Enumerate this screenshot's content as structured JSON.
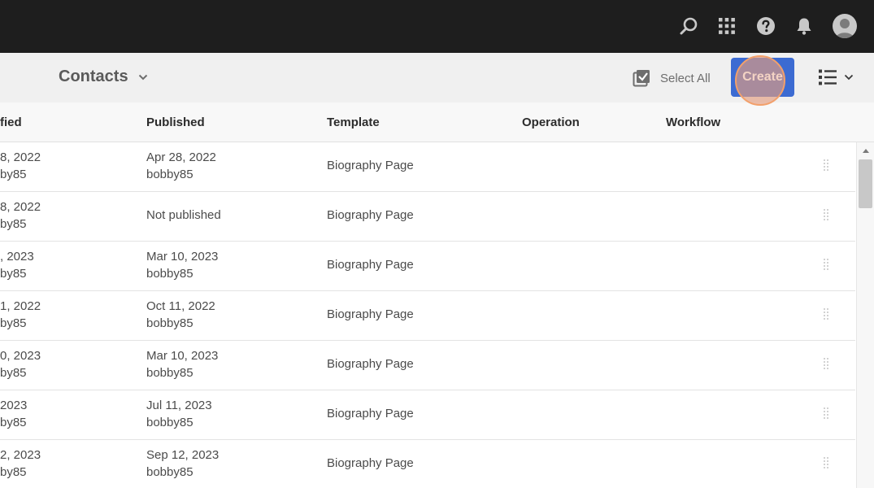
{
  "header": {
    "icons": [
      "search-icon",
      "apps-grid-icon",
      "help-icon",
      "bell-icon",
      "user-avatar"
    ]
  },
  "actionbar": {
    "title": "Contacts",
    "select_all": "Select All",
    "create": "Create"
  },
  "columns": {
    "modified": "fied",
    "published": "Published",
    "template": "Template",
    "operation": "Operation",
    "workflow": "Workflow"
  },
  "rows": [
    {
      "modified_date": "8, 2022",
      "modified_by": "by85",
      "published_date": "Apr 28, 2022",
      "published_by": "bobby85",
      "template": "Biography Page"
    },
    {
      "modified_date": "8, 2022",
      "modified_by": "by85",
      "published_date": "Not published",
      "published_by": "",
      "template": "Biography Page"
    },
    {
      "modified_date": ", 2023",
      "modified_by": "by85",
      "published_date": "Mar 10, 2023",
      "published_by": "bobby85",
      "template": "Biography Page"
    },
    {
      "modified_date": "1, 2022",
      "modified_by": "by85",
      "published_date": "Oct 11, 2022",
      "published_by": "bobby85",
      "template": "Biography Page"
    },
    {
      "modified_date": "0, 2023",
      "modified_by": "by85",
      "published_date": "Mar 10, 2023",
      "published_by": "bobby85",
      "template": "Biography Page"
    },
    {
      "modified_date": " 2023",
      "modified_by": "by85",
      "published_date": "Jul 11, 2023",
      "published_by": "bobby85",
      "template": "Biography Page"
    },
    {
      "modified_date": "2, 2023",
      "modified_by": "by85",
      "published_date": "Sep 12, 2023",
      "published_by": "bobby85",
      "template": "Biography Page"
    }
  ],
  "colors": {
    "shell": "#1e1e1e",
    "accent": "#3c6bd2",
    "click_highlight": "#f2a06b"
  }
}
